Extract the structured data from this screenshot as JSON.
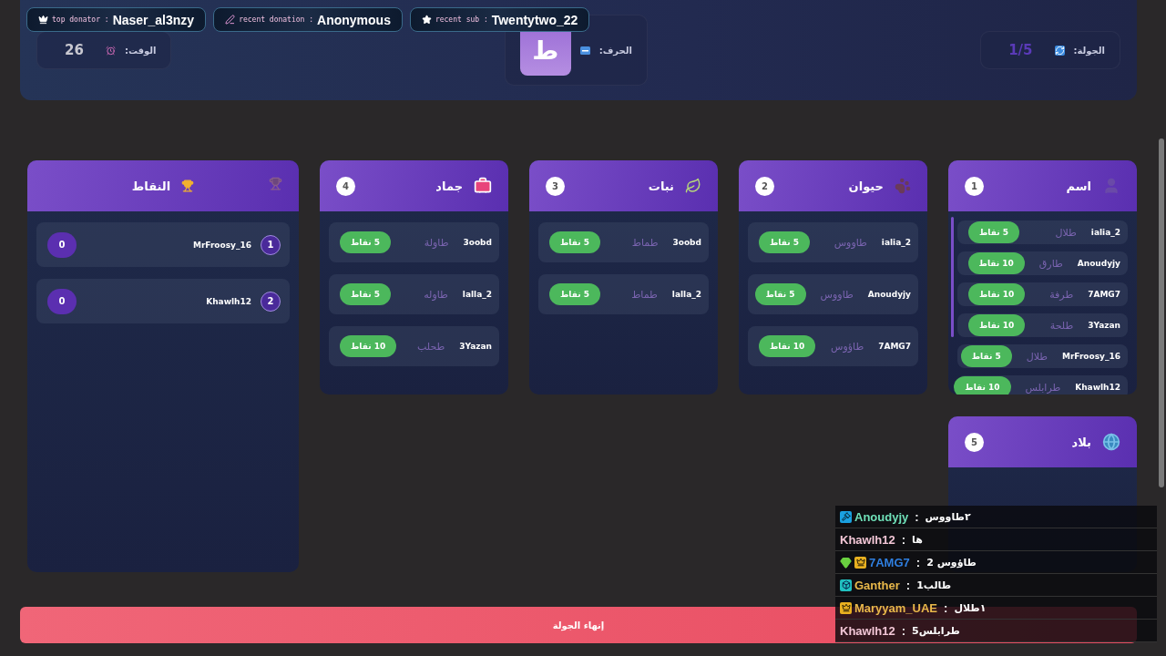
{
  "banners": [
    {
      "kind": "star",
      "label": "recent sub :",
      "value": "Twentytwo_22"
    },
    {
      "kind": "pen",
      "label": "recent donation :",
      "value": "Anonymous"
    },
    {
      "kind": "crown",
      "label": "top donator :",
      "value": "Naser_al3nzy"
    }
  ],
  "header": {
    "round": {
      "label": "الجولة:",
      "value": "1/5"
    },
    "letter": {
      "label": "الحرف:",
      "value": "ط"
    },
    "time": {
      "label": "الوقت:",
      "value": "26"
    }
  },
  "categories": [
    {
      "kind": "person",
      "title": "اسم",
      "number": "1",
      "scrollable": true,
      "entries": [
        {
          "player": "ialia_2",
          "answer": "طلال",
          "points": "5 نقاط"
        },
        {
          "player": "Anoudyjy",
          "answer": "طارق",
          "points": "10 نقاط"
        },
        {
          "player": "7AMG7",
          "answer": "طرفة",
          "points": "10 نقاط"
        },
        {
          "player": "3Yazan",
          "answer": "طلحة",
          "points": "10 نقاط"
        },
        {
          "player": "MrFroosy_16",
          "answer": "طلال",
          "points": "5 نقاط"
        },
        {
          "player": "Khawlh12",
          "answer": "طرابلس",
          "points": "10 نقاط"
        }
      ]
    },
    {
      "kind": "paw",
      "title": "حيوان",
      "number": "2",
      "scrollable": false,
      "entries": [
        {
          "player": "ialia_2",
          "answer": "طاووس",
          "points": "5 نقاط"
        },
        {
          "player": "Anoudyjy",
          "answer": "طاووس",
          "points": "5 نقاط"
        },
        {
          "player": "7AMG7",
          "answer": "طاؤوس",
          "points": "10 نقاط"
        }
      ]
    },
    {
      "kind": "leaf",
      "title": "نبات",
      "number": "3",
      "scrollable": false,
      "entries": [
        {
          "player": "3oobd",
          "answer": "طماط",
          "points": "5 نقاط"
        },
        {
          "player": "lalla_2",
          "answer": "طماط",
          "points": "5 نقاط"
        }
      ]
    },
    {
      "kind": "toolbox",
      "title": "جماد",
      "number": "4",
      "scrollable": false,
      "entries": [
        {
          "player": "3oobd",
          "answer": "طاولة",
          "points": "5 نقاط"
        },
        {
          "player": "lalla_2",
          "answer": "طاوله",
          "points": "5 نقاط"
        },
        {
          "player": "3Yazan",
          "answer": "طحلب",
          "points": "10 نقاط"
        }
      ]
    },
    {
      "kind": "globe",
      "title": "بلاد",
      "number": "5",
      "scrollable": false
    }
  ],
  "scores": {
    "title": "النقاط",
    "players": [
      {
        "rank": "1",
        "name": "MrFroosy_16",
        "score": "0"
      },
      {
        "rank": "2",
        "name": "Khawlh12",
        "score": "0"
      }
    ]
  },
  "end_button": "إنهاء الجولة",
  "chat": [
    {
      "badges": [
        {
          "kind": "gavel"
        }
      ],
      "name": "Anoudyjy",
      "color": "#6fe0b8",
      "separator": ":",
      "message": "٢طاووس"
    },
    {
      "name": "Khawlh12",
      "color": "#f2c6d6",
      "separator": ":",
      "message": "ها"
    },
    {
      "badges": [
        {
          "kind": "gem"
        },
        {
          "kind": "crown"
        }
      ],
      "name": "7AMG7",
      "color": "#2f7fe0",
      "separator": ":",
      "message": "طاؤوس 2"
    },
    {
      "badges": [
        {
          "kind": "box"
        }
      ],
      "name": "Ganther",
      "color": "#e8b84a",
      "separator": ":",
      "message": "طالب1"
    },
    {
      "badges": [
        {
          "kind": "crown"
        }
      ],
      "name": "Maryyam_UAE",
      "color": "#e8b84a",
      "separator": ":",
      "message": "١طلال"
    },
    {
      "name": "Khawlh12",
      "color": "#f2c6d6",
      "separator": ":",
      "message": "طرابلس5"
    }
  ]
}
